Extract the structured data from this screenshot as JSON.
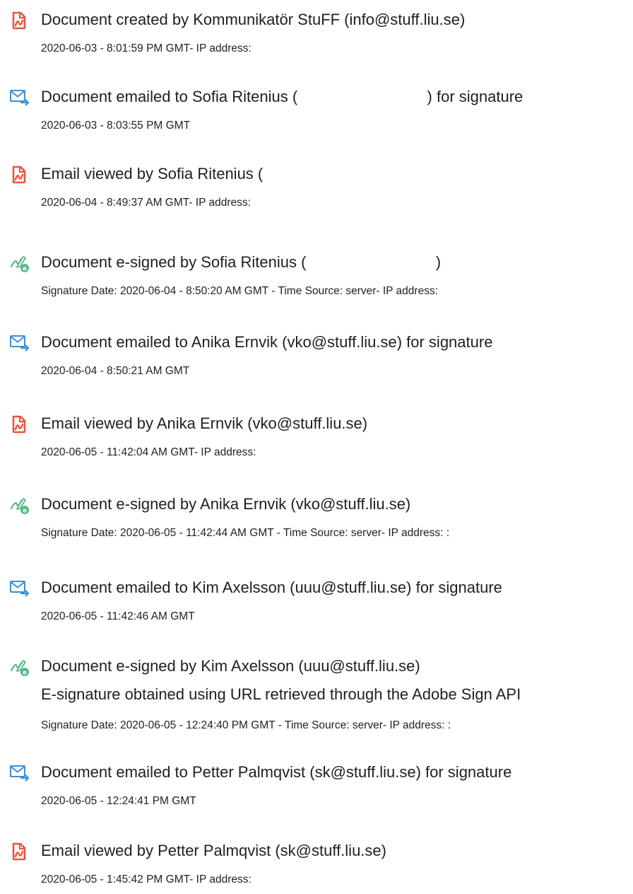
{
  "colors": {
    "created_icon": "#e8553b",
    "emailed_icon": "#3a8fd6",
    "signed_icon": "#58b88a"
  },
  "events": [
    {
      "icon": "document-icon",
      "title": "Document created by Kommunikatör StuFF (info@stuff.liu.se)",
      "detail": "2020-06-03 - 8:01:59 PM GMT- IP address:"
    },
    {
      "icon": "email-icon",
      "title": "Document emailed to Sofia Ritenius (                              ) for signature",
      "detail": "2020-06-03 - 8:03:55 PM GMT"
    },
    {
      "icon": "document-icon",
      "title": "Email viewed by Sofia Ritenius (",
      "detail": "2020-06-04 - 8:49:37 AM GMT- IP address:"
    },
    {
      "icon": "esign-icon",
      "title": "Document e-signed by Sofia Ritenius (                              )",
      "detail": "Signature Date: 2020-06-04 - 8:50:20 AM GMT - Time Source: server- IP address:"
    },
    {
      "icon": "email-icon",
      "title": "Document emailed to Anika Ernvik (vko@stuff.liu.se) for signature",
      "detail": "2020-06-04 - 8:50:21 AM GMT"
    },
    {
      "icon": "document-icon",
      "title": "Email viewed by Anika Ernvik (vko@stuff.liu.se)",
      "detail": "2020-06-05 - 11:42:04 AM GMT- IP address:"
    },
    {
      "icon": "esign-icon",
      "title": "Document e-signed by Anika Ernvik (vko@stuff.liu.se)",
      "detail": "Signature Date: 2020-06-05 - 11:42:44 AM GMT - Time Source: server- IP address: :"
    },
    {
      "icon": "email-icon",
      "title": "Document emailed to Kim Axelsson (uuu@stuff.liu.se) for signature",
      "detail": "2020-06-05 - 11:42:46 AM GMT"
    },
    {
      "icon": "esign-icon",
      "title": "Document e-signed by Kim Axelsson (uuu@stuff.liu.se)",
      "subtitle": "E-signature obtained using URL retrieved through the Adobe Sign API",
      "detail": "Signature Date: 2020-06-05 - 12:24:40 PM GMT - Time Source: server- IP address: :"
    },
    {
      "icon": "email-icon",
      "title": "Document emailed to Petter Palmqvist (sk@stuff.liu.se) for signature",
      "detail": "2020-06-05 - 12:24:41 PM GMT"
    },
    {
      "icon": "document-icon",
      "title": "Email viewed by Petter Palmqvist (sk@stuff.liu.se)",
      "detail": "2020-06-05 - 1:45:42 PM GMT- IP address:"
    }
  ]
}
